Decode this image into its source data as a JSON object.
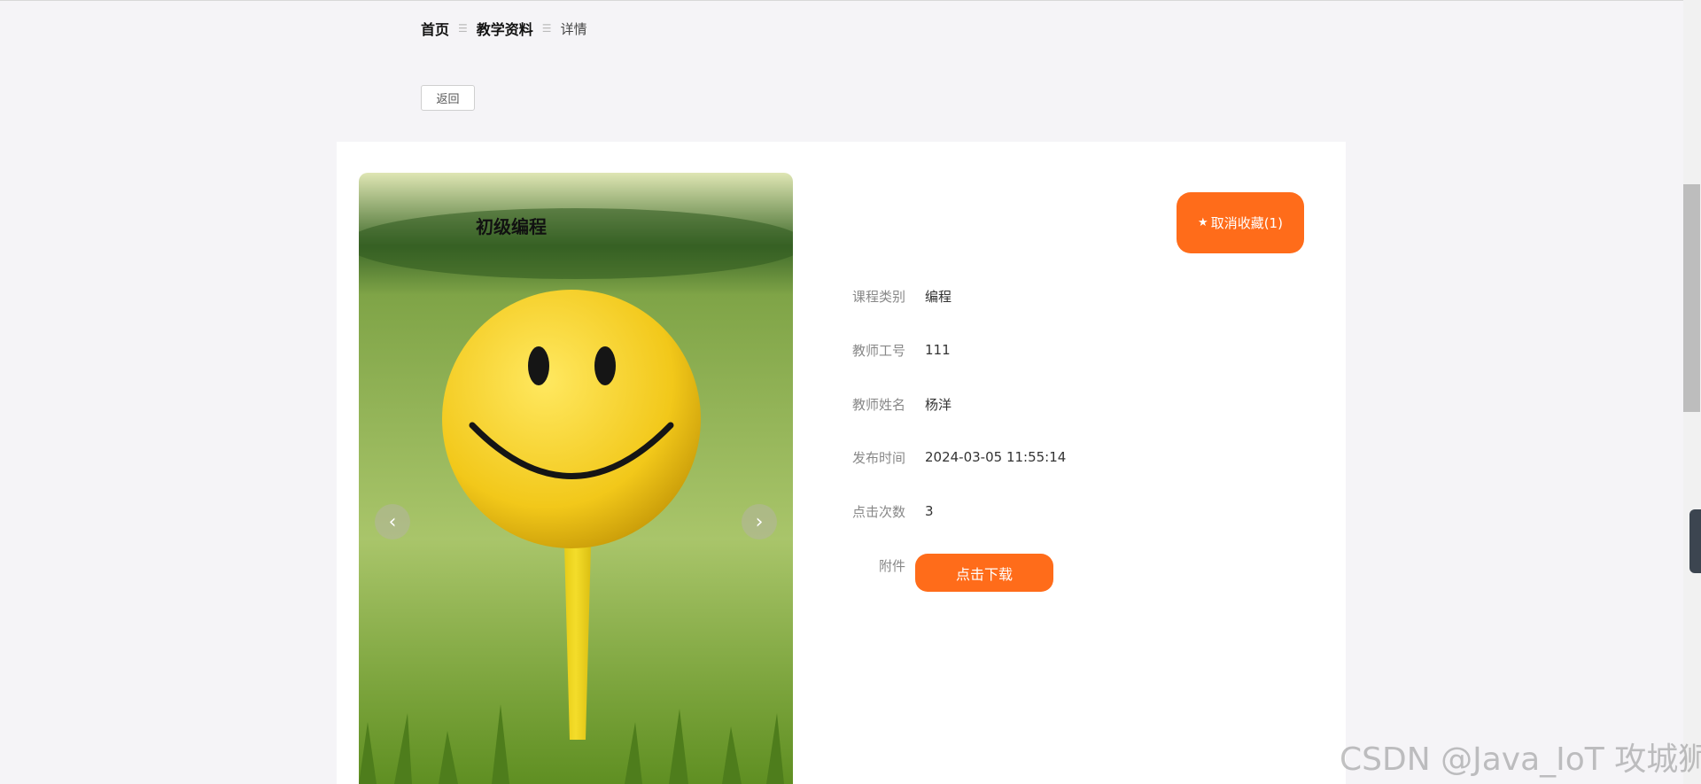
{
  "breadcrumb": {
    "home": "首页",
    "section": "教学资料",
    "current": "详情"
  },
  "back_label": "返回",
  "course": {
    "title": "初级编程",
    "favorite_label": "取消收藏(1)",
    "fields": [
      {
        "label": "课程类别",
        "value": "编程"
      },
      {
        "label": "教师工号",
        "value": "111"
      },
      {
        "label": "教师姓名",
        "value": "杨洋"
      },
      {
        "label": "发布时间",
        "value": "2024-03-05 11:55:14"
      },
      {
        "label": "点击次数",
        "value": "3"
      }
    ],
    "attachment_label": "附件",
    "download_label": "点击下载"
  },
  "carousel": {
    "prev_icon": "‹",
    "next_icon": "›"
  },
  "watermark": "CSDN @Java_IoT 攻城狮",
  "colors": {
    "accent": "#ff6c1a",
    "background": "#f5f4f7"
  }
}
